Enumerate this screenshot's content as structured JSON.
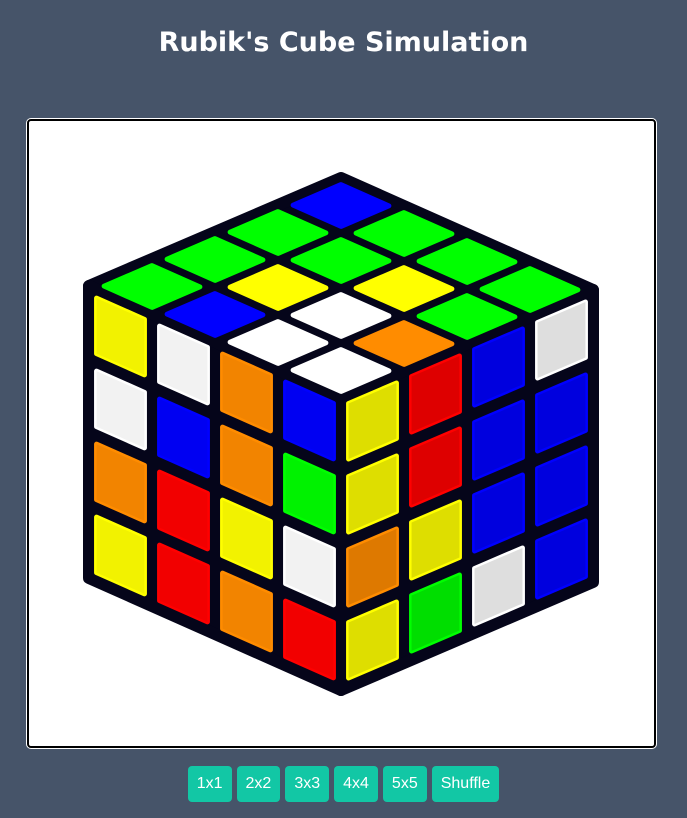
{
  "page": {
    "title": "Rubik's Cube Simulation"
  },
  "controls": {
    "buttons": [
      {
        "label": "1x1",
        "name": "size-1x1-button"
      },
      {
        "label": "2x2",
        "name": "size-2x2-button"
      },
      {
        "label": "3x3",
        "name": "size-3x3-button"
      },
      {
        "label": "4x4",
        "name": "size-4x4-button"
      },
      {
        "label": "5x5",
        "name": "size-5x5-button"
      },
      {
        "label": "Shuffle",
        "name": "shuffle-button"
      }
    ]
  },
  "colors": {
    "background": "#465469",
    "button": "#12c7a5",
    "cube_body": "#05051a",
    "sticker_palette": {
      "G": "#00ff00",
      "B": "#0000ff",
      "W": "#ffffff",
      "Y": "#ffff00",
      "O": "#ff8c00",
      "R": "#ff0000"
    }
  },
  "cube": {
    "size": 4,
    "faces": {
      "top": [
        [
          "B",
          "G",
          "G",
          "G"
        ],
        [
          "G",
          "G",
          "Y",
          "G"
        ],
        [
          "G",
          "Y",
          "W",
          "O"
        ],
        [
          "G",
          "B",
          "W",
          "W"
        ]
      ],
      "left": [
        [
          "Y",
          "W",
          "O",
          "B"
        ],
        [
          "W",
          "B",
          "O",
          "G"
        ],
        [
          "O",
          "R",
          "Y",
          "W"
        ],
        [
          "Y",
          "R",
          "O",
          "R"
        ]
      ],
      "right": [
        [
          "Y",
          "R",
          "B",
          "W"
        ],
        [
          "Y",
          "R",
          "B",
          "B"
        ],
        [
          "O",
          "Y",
          "B",
          "B"
        ],
        [
          "Y",
          "G",
          "W",
          "B"
        ]
      ]
    }
  }
}
